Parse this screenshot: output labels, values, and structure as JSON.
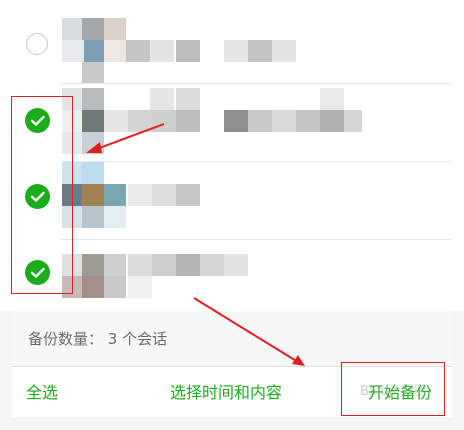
{
  "conversations": [
    {
      "selected": false
    },
    {
      "selected": true
    },
    {
      "selected": true
    },
    {
      "selected": true
    }
  ],
  "footer": {
    "backup_count_text": "备份数量： 3 个会话",
    "select_all_label": "全选",
    "select_time_content_label": "选择时间和内容",
    "start_backup_label": "开始备份"
  },
  "colors": {
    "accent": "#1aad19",
    "annotation": "#e02020"
  },
  "watermark": "Baidu 经验"
}
